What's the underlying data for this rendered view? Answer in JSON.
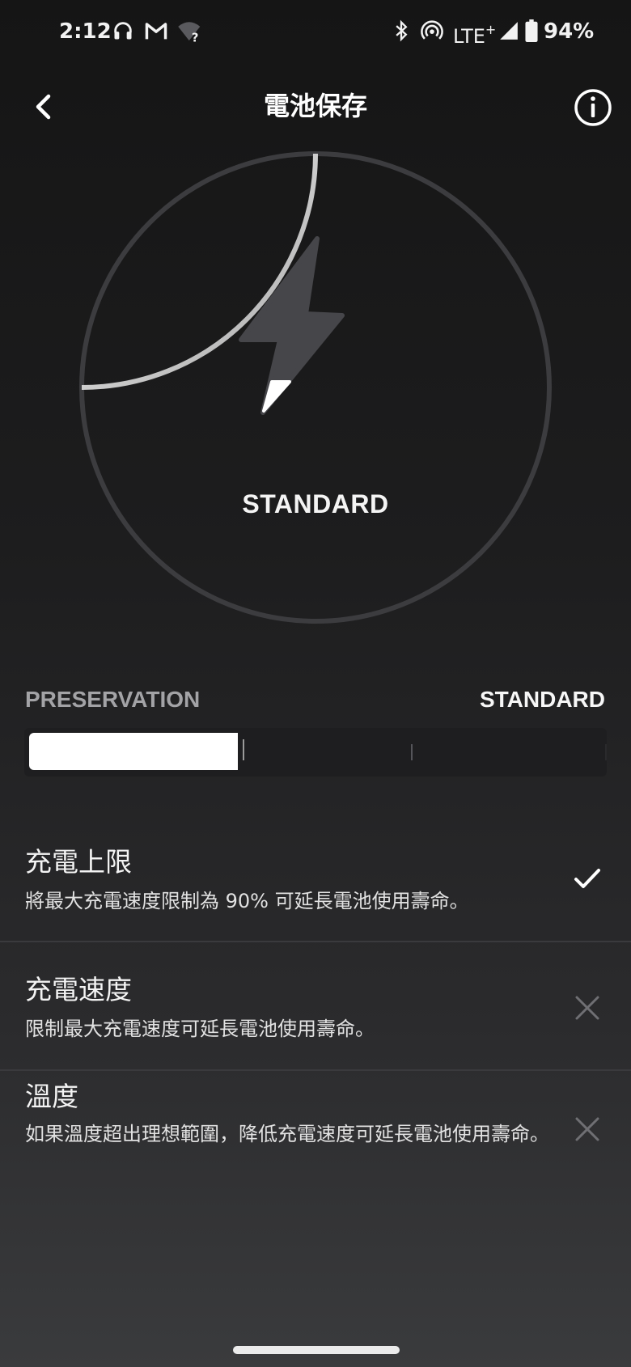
{
  "status_bar": {
    "time": "2:12",
    "network": "LTE",
    "network_suffix": "+",
    "battery_percent": "94%",
    "icons": [
      "headphones-icon",
      "gmail-icon",
      "wifi-unknown-icon",
      "bluetooth-icon",
      "hotspot-icon",
      "signal-icon",
      "battery-icon"
    ]
  },
  "header": {
    "title": "電池保存",
    "back_icon": "chevron-left-icon",
    "info_icon": "info-circle-icon"
  },
  "gauge": {
    "label": "STANDARD",
    "icon": "lightning-bolt-icon",
    "level": 0.25,
    "colors": {
      "ring": "#3c3c3f",
      "progress": "#d6d6d6",
      "bolt": "#46464a",
      "bolt_fill": "#ffffff"
    }
  },
  "mode_slider": {
    "left_label": "PRESERVATION",
    "right_label": "STANDARD",
    "fill_fraction": 0.365
  },
  "settings": [
    {
      "title": "充電上限",
      "description": "將最大充電速度限制為 90% 可延長電池使用壽命。",
      "status": "enabled",
      "status_icon": "checkmark-icon"
    },
    {
      "title": "充電速度",
      "description": "限制最大充電速度可延長電池使用壽命。",
      "status": "disabled",
      "status_icon": "close-icon"
    },
    {
      "title": "溫度",
      "description": "如果溫度超出理想範圍，降低充電速度可延長電池使用壽命。",
      "status": "disabled",
      "status_icon": "close-icon"
    }
  ]
}
